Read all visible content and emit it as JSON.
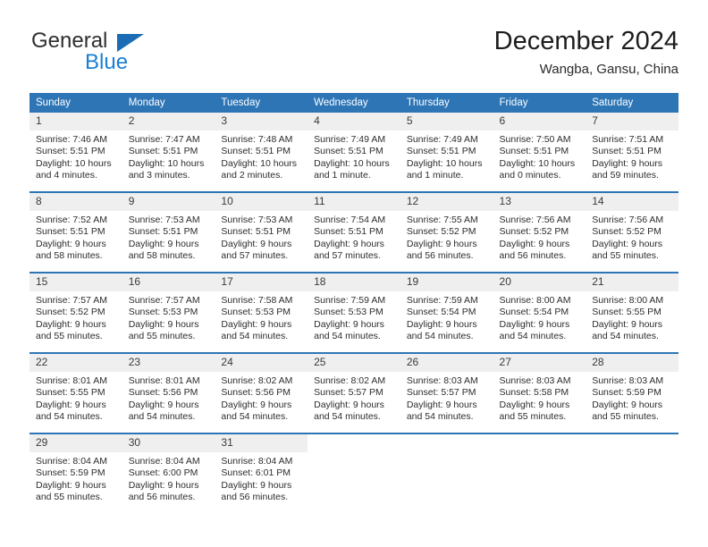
{
  "brand": {
    "name_top": "General",
    "name_bottom": "Blue",
    "triangle_color": "#1b6cb5",
    "blue_color": "#1b7fd4"
  },
  "header": {
    "title": "December 2024",
    "subtitle": "Wangba, Gansu, China",
    "header_bg": "#2e75b6",
    "daynum_bg": "#efefef"
  },
  "weekdays": [
    "Sunday",
    "Monday",
    "Tuesday",
    "Wednesday",
    "Thursday",
    "Friday",
    "Saturday"
  ],
  "labels": {
    "sunrise": "Sunrise:",
    "sunset": "Sunset:",
    "daylight": "Daylight:"
  },
  "weeks": [
    [
      {
        "day": "1",
        "sunrise": "Sunrise: 7:46 AM",
        "sunset": "Sunset: 5:51 PM",
        "daylight1": "Daylight: 10 hours",
        "daylight2": "and 4 minutes."
      },
      {
        "day": "2",
        "sunrise": "Sunrise: 7:47 AM",
        "sunset": "Sunset: 5:51 PM",
        "daylight1": "Daylight: 10 hours",
        "daylight2": "and 3 minutes."
      },
      {
        "day": "3",
        "sunrise": "Sunrise: 7:48 AM",
        "sunset": "Sunset: 5:51 PM",
        "daylight1": "Daylight: 10 hours",
        "daylight2": "and 2 minutes."
      },
      {
        "day": "4",
        "sunrise": "Sunrise: 7:49 AM",
        "sunset": "Sunset: 5:51 PM",
        "daylight1": "Daylight: 10 hours",
        "daylight2": "and 1 minute."
      },
      {
        "day": "5",
        "sunrise": "Sunrise: 7:49 AM",
        "sunset": "Sunset: 5:51 PM",
        "daylight1": "Daylight: 10 hours",
        "daylight2": "and 1 minute."
      },
      {
        "day": "6",
        "sunrise": "Sunrise: 7:50 AM",
        "sunset": "Sunset: 5:51 PM",
        "daylight1": "Daylight: 10 hours",
        "daylight2": "and 0 minutes."
      },
      {
        "day": "7",
        "sunrise": "Sunrise: 7:51 AM",
        "sunset": "Sunset: 5:51 PM",
        "daylight1": "Daylight: 9 hours",
        "daylight2": "and 59 minutes."
      }
    ],
    [
      {
        "day": "8",
        "sunrise": "Sunrise: 7:52 AM",
        "sunset": "Sunset: 5:51 PM",
        "daylight1": "Daylight: 9 hours",
        "daylight2": "and 58 minutes."
      },
      {
        "day": "9",
        "sunrise": "Sunrise: 7:53 AM",
        "sunset": "Sunset: 5:51 PM",
        "daylight1": "Daylight: 9 hours",
        "daylight2": "and 58 minutes."
      },
      {
        "day": "10",
        "sunrise": "Sunrise: 7:53 AM",
        "sunset": "Sunset: 5:51 PM",
        "daylight1": "Daylight: 9 hours",
        "daylight2": "and 57 minutes."
      },
      {
        "day": "11",
        "sunrise": "Sunrise: 7:54 AM",
        "sunset": "Sunset: 5:51 PM",
        "daylight1": "Daylight: 9 hours",
        "daylight2": "and 57 minutes."
      },
      {
        "day": "12",
        "sunrise": "Sunrise: 7:55 AM",
        "sunset": "Sunset: 5:52 PM",
        "daylight1": "Daylight: 9 hours",
        "daylight2": "and 56 minutes."
      },
      {
        "day": "13",
        "sunrise": "Sunrise: 7:56 AM",
        "sunset": "Sunset: 5:52 PM",
        "daylight1": "Daylight: 9 hours",
        "daylight2": "and 56 minutes."
      },
      {
        "day": "14",
        "sunrise": "Sunrise: 7:56 AM",
        "sunset": "Sunset: 5:52 PM",
        "daylight1": "Daylight: 9 hours",
        "daylight2": "and 55 minutes."
      }
    ],
    [
      {
        "day": "15",
        "sunrise": "Sunrise: 7:57 AM",
        "sunset": "Sunset: 5:52 PM",
        "daylight1": "Daylight: 9 hours",
        "daylight2": "and 55 minutes."
      },
      {
        "day": "16",
        "sunrise": "Sunrise: 7:57 AM",
        "sunset": "Sunset: 5:53 PM",
        "daylight1": "Daylight: 9 hours",
        "daylight2": "and 55 minutes."
      },
      {
        "day": "17",
        "sunrise": "Sunrise: 7:58 AM",
        "sunset": "Sunset: 5:53 PM",
        "daylight1": "Daylight: 9 hours",
        "daylight2": "and 54 minutes."
      },
      {
        "day": "18",
        "sunrise": "Sunrise: 7:59 AM",
        "sunset": "Sunset: 5:53 PM",
        "daylight1": "Daylight: 9 hours",
        "daylight2": "and 54 minutes."
      },
      {
        "day": "19",
        "sunrise": "Sunrise: 7:59 AM",
        "sunset": "Sunset: 5:54 PM",
        "daylight1": "Daylight: 9 hours",
        "daylight2": "and 54 minutes."
      },
      {
        "day": "20",
        "sunrise": "Sunrise: 8:00 AM",
        "sunset": "Sunset: 5:54 PM",
        "daylight1": "Daylight: 9 hours",
        "daylight2": "and 54 minutes."
      },
      {
        "day": "21",
        "sunrise": "Sunrise: 8:00 AM",
        "sunset": "Sunset: 5:55 PM",
        "daylight1": "Daylight: 9 hours",
        "daylight2": "and 54 minutes."
      }
    ],
    [
      {
        "day": "22",
        "sunrise": "Sunrise: 8:01 AM",
        "sunset": "Sunset: 5:55 PM",
        "daylight1": "Daylight: 9 hours",
        "daylight2": "and 54 minutes."
      },
      {
        "day": "23",
        "sunrise": "Sunrise: 8:01 AM",
        "sunset": "Sunset: 5:56 PM",
        "daylight1": "Daylight: 9 hours",
        "daylight2": "and 54 minutes."
      },
      {
        "day": "24",
        "sunrise": "Sunrise: 8:02 AM",
        "sunset": "Sunset: 5:56 PM",
        "daylight1": "Daylight: 9 hours",
        "daylight2": "and 54 minutes."
      },
      {
        "day": "25",
        "sunrise": "Sunrise: 8:02 AM",
        "sunset": "Sunset: 5:57 PM",
        "daylight1": "Daylight: 9 hours",
        "daylight2": "and 54 minutes."
      },
      {
        "day": "26",
        "sunrise": "Sunrise: 8:03 AM",
        "sunset": "Sunset: 5:57 PM",
        "daylight1": "Daylight: 9 hours",
        "daylight2": "and 54 minutes."
      },
      {
        "day": "27",
        "sunrise": "Sunrise: 8:03 AM",
        "sunset": "Sunset: 5:58 PM",
        "daylight1": "Daylight: 9 hours",
        "daylight2": "and 55 minutes."
      },
      {
        "day": "28",
        "sunrise": "Sunrise: 8:03 AM",
        "sunset": "Sunset: 5:59 PM",
        "daylight1": "Daylight: 9 hours",
        "daylight2": "and 55 minutes."
      }
    ],
    [
      {
        "day": "29",
        "sunrise": "Sunrise: 8:04 AM",
        "sunset": "Sunset: 5:59 PM",
        "daylight1": "Daylight: 9 hours",
        "daylight2": "and 55 minutes."
      },
      {
        "day": "30",
        "sunrise": "Sunrise: 8:04 AM",
        "sunset": "Sunset: 6:00 PM",
        "daylight1": "Daylight: 9 hours",
        "daylight2": "and 56 minutes."
      },
      {
        "day": "31",
        "sunrise": "Sunrise: 8:04 AM",
        "sunset": "Sunset: 6:01 PM",
        "daylight1": "Daylight: 9 hours",
        "daylight2": "and 56 minutes."
      },
      {
        "day": "",
        "sunrise": "",
        "sunset": "",
        "daylight1": "",
        "daylight2": ""
      },
      {
        "day": "",
        "sunrise": "",
        "sunset": "",
        "daylight1": "",
        "daylight2": ""
      },
      {
        "day": "",
        "sunrise": "",
        "sunset": "",
        "daylight1": "",
        "daylight2": ""
      },
      {
        "day": "",
        "sunrise": "",
        "sunset": "",
        "daylight1": "",
        "daylight2": ""
      }
    ]
  ]
}
